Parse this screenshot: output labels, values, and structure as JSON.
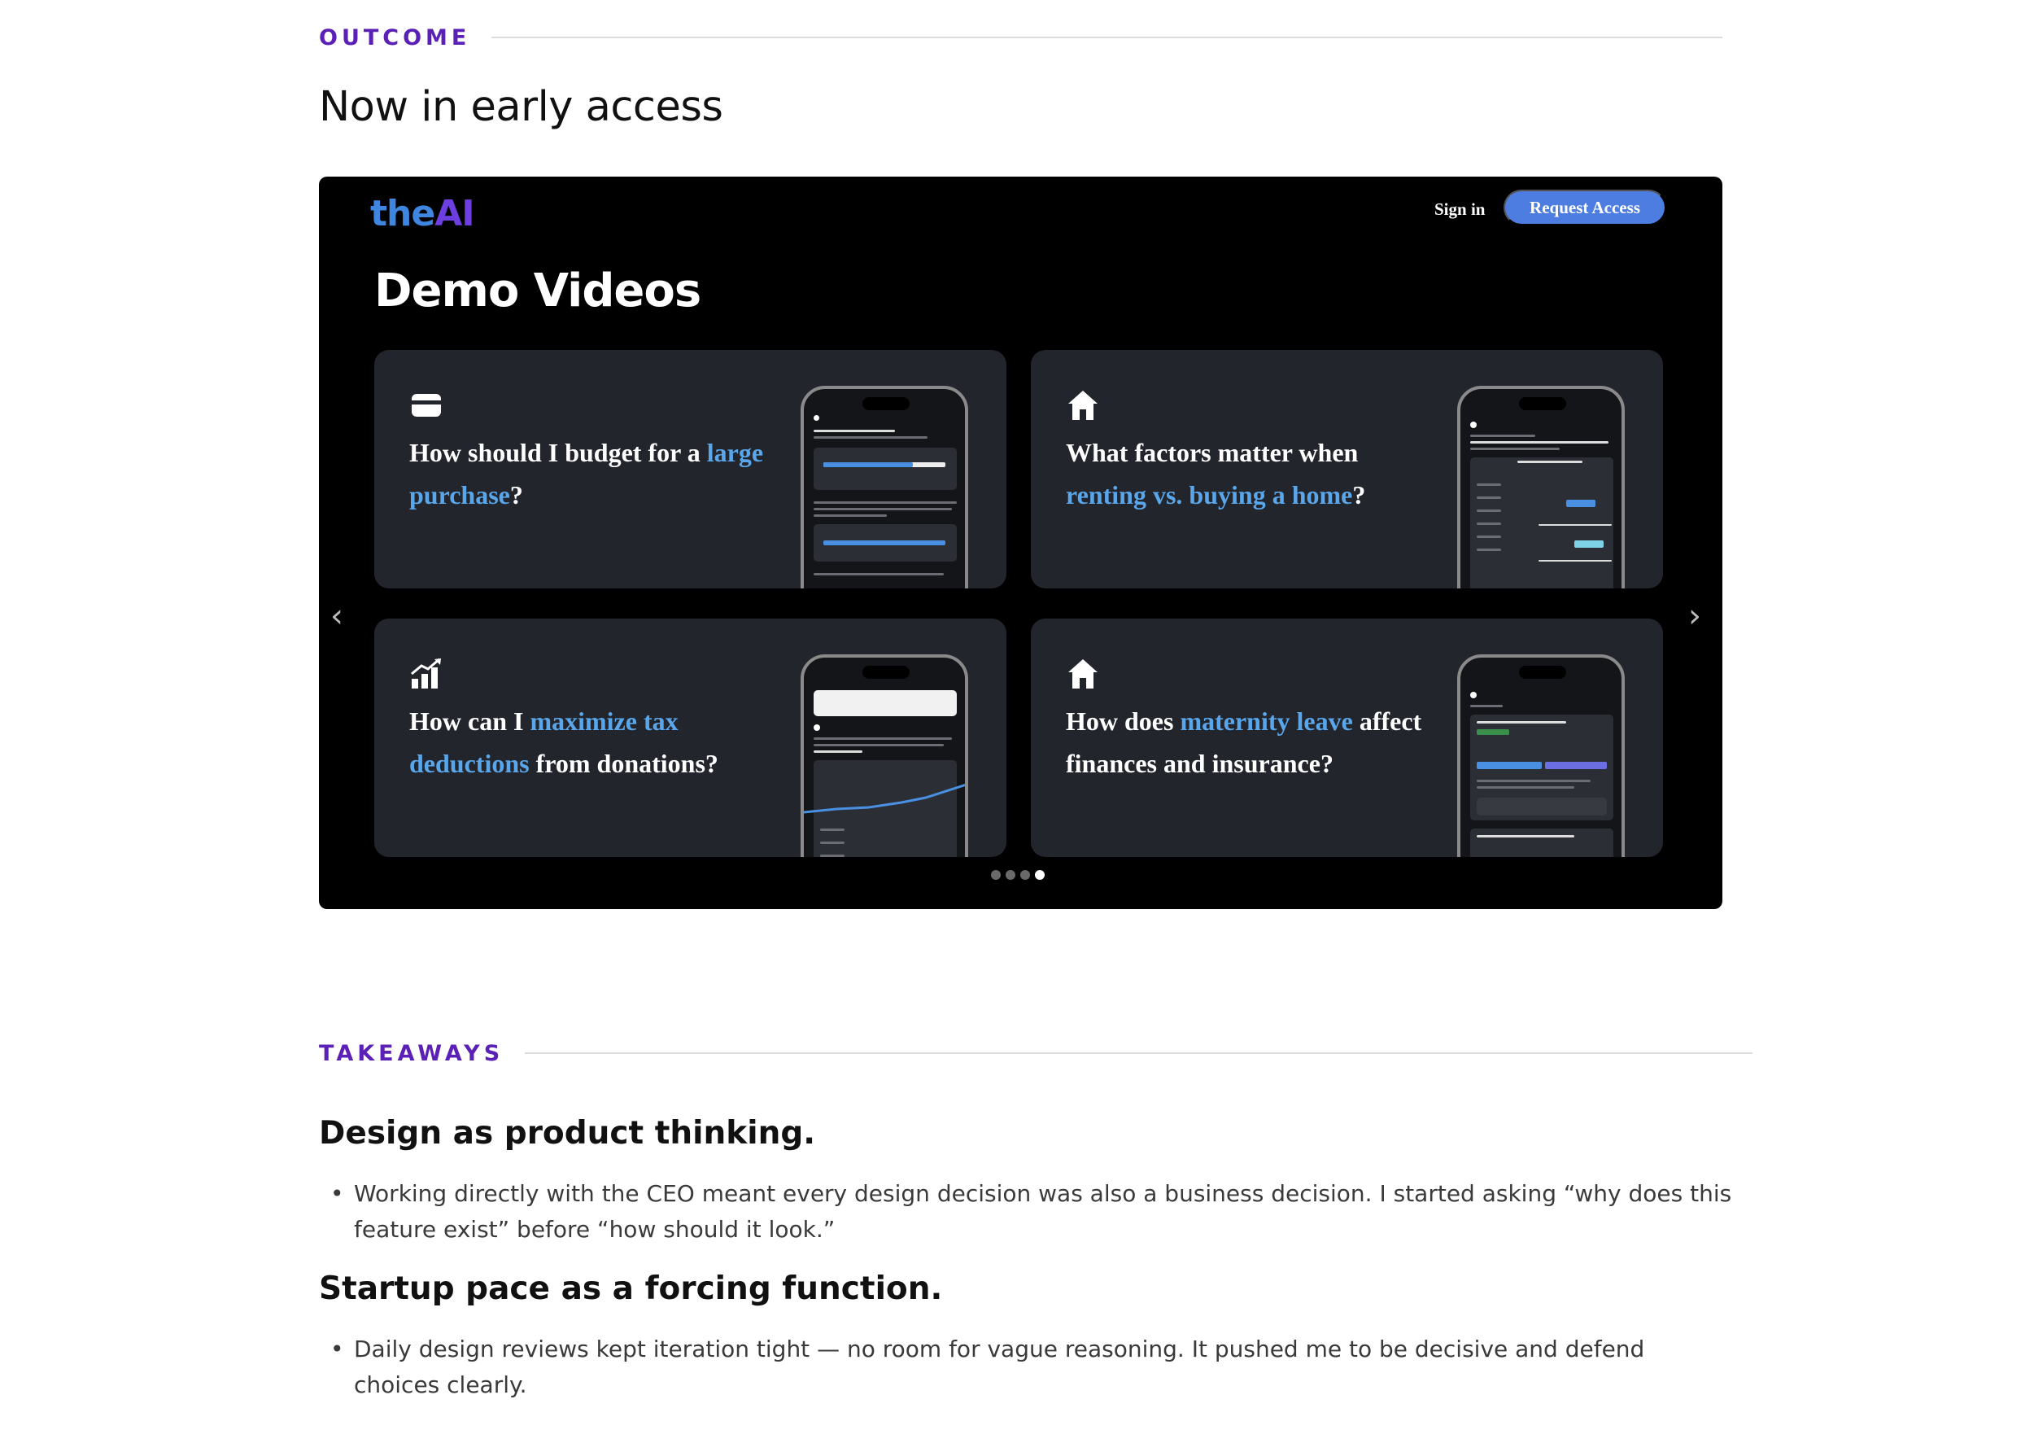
{
  "outcome": {
    "label": "OUTCOME",
    "title": "Now in early access"
  },
  "demo": {
    "logo_part1": "the",
    "logo_part2": "AI",
    "sign_in": "Sign in",
    "request_access": "Request Access",
    "title": "Demo Videos",
    "cards": [
      {
        "icon": "wallet-icon",
        "segments": [
          {
            "text": "How should I budget for a ",
            "highlight": false
          },
          {
            "text": "large purchase",
            "highlight": true
          },
          {
            "text": "?",
            "highlight": false
          }
        ]
      },
      {
        "icon": "home-icon",
        "segments": [
          {
            "text": "What factors matter when ",
            "highlight": false
          },
          {
            "text": "renting vs. buying a home",
            "highlight": true
          },
          {
            "text": "?",
            "highlight": false
          }
        ]
      },
      {
        "icon": "growth-chart-icon",
        "segments": [
          {
            "text": "How can I ",
            "highlight": false
          },
          {
            "text": "maximize tax deductions",
            "highlight": true
          },
          {
            "text": " from donations?",
            "highlight": false
          }
        ]
      },
      {
        "icon": "home-icon",
        "segments": [
          {
            "text": "How does ",
            "highlight": false
          },
          {
            "text": "maternity leave",
            "highlight": true
          },
          {
            "text": " affect finances and insurance?",
            "highlight": false
          }
        ]
      }
    ],
    "carousel": {
      "total": 4,
      "active": 4
    },
    "colors": {
      "accent": "#5aa6ea",
      "button": "#4d7de0",
      "label": "#5b21b6"
    }
  },
  "takeaways": {
    "label": "TAKEAWAYS",
    "items": [
      {
        "heading": "Design as product thinking.",
        "bullets": [
          "Working directly with the CEO meant every design decision was also a business decision. I started asking “why does this feature exist” before “how should it look.”"
        ]
      },
      {
        "heading": "Startup pace as a forcing function.",
        "bullets": [
          "Daily design reviews kept iteration tight — no room for vague reasoning. It pushed me to be decisive and defend choices clearly."
        ]
      }
    ]
  }
}
